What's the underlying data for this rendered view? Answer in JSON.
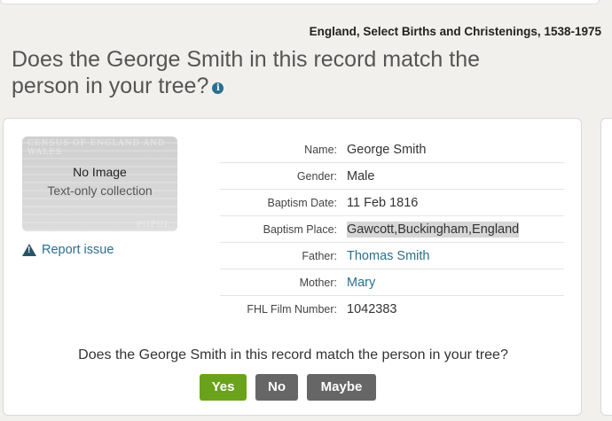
{
  "header": {
    "collection": "England, Select Births and Christenings, 1538-1975",
    "heading": "Does the George Smith in this record match the person in your tree?",
    "info_icon": "i"
  },
  "thumbnail": {
    "no_image": "No Image",
    "text_only": "Text-only collection",
    "faint_top": "CENSUS OF ENGLAND AND WALES",
    "faint_bottom": "POPUL"
  },
  "report": {
    "label": "Report issue",
    "icon": "warning-icon"
  },
  "fields": [
    {
      "label": "Name:",
      "value": "George Smith"
    },
    {
      "label": "Gender:",
      "value": "Male"
    },
    {
      "label": "Baptism Date:",
      "value": "11 Feb 1816"
    },
    {
      "label": "Baptism Place:",
      "value": "Gawcott,Buckingham,England"
    },
    {
      "label": "Father:",
      "value": "Thomas Smith"
    },
    {
      "label": "Mother:",
      "value": "Mary"
    },
    {
      "label": "FHL Film Number:",
      "value": "1042383"
    }
  ],
  "question": "Does the George Smith in this record match the person in your tree?",
  "buttons": {
    "yes": "Yes",
    "no": "No",
    "maybe": "Maybe"
  },
  "colors": {
    "link": "#2a6f8f",
    "yes": "#6aa31b",
    "neutral": "#666666"
  }
}
